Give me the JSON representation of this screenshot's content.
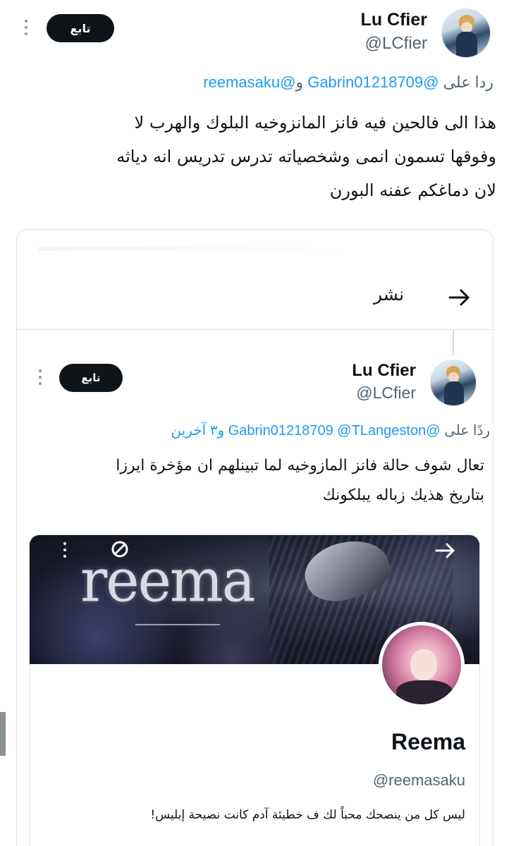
{
  "main_tweet": {
    "author_name": "Lu Cfier",
    "author_handle": "@LCfier",
    "follow_label": "تابع",
    "reply_prefix": "ردا على",
    "reply_mention_1": "@Gabrin01218709",
    "reply_and": "و",
    "reply_mention_2": "@reemasaku",
    "text_lines": [
      "هذا الى فالحين فيه فانز المانزوخيه البلوك والهرب لا",
      "وفوقها تسمون انمى وشخصياته تدرس تدريس انه دياثه",
      "لان دماغكم عفنه البورن"
    ]
  },
  "quote_card": {
    "repost_label": "نشر",
    "tweet": {
      "author_name": "Lu Cfier",
      "author_handle": "@LCfier",
      "follow_label": "تابع",
      "reply_prefix": "ردًا على",
      "reply_mentions": "@Gabrin01218709 @TLangeston",
      "reply_others": "و٣ آخرين",
      "text_lines": [
        "تعال شوف حالة فانز المازوخيه لما تبينلهم ان مؤخرة ايرزا",
        "بتاريخ هذيك زباله يبلكونك"
      ]
    },
    "profile": {
      "banner_text": "reema",
      "name": "Reema",
      "handle": "@reemasaku",
      "bio": "ليس كل من ينصحك محباً لك ف خطيئة آدم كانت نصيحة إبليس!"
    }
  },
  "colors": {
    "text": "#0f1419",
    "secondary": "#536471",
    "link": "#1d9bf0",
    "button_bg": "#0f1419",
    "border": "#dfe4e8"
  },
  "icons": [
    "more-icon",
    "repost-arrow-icon",
    "banner-arrow-icon",
    "no-sign-icon"
  ]
}
